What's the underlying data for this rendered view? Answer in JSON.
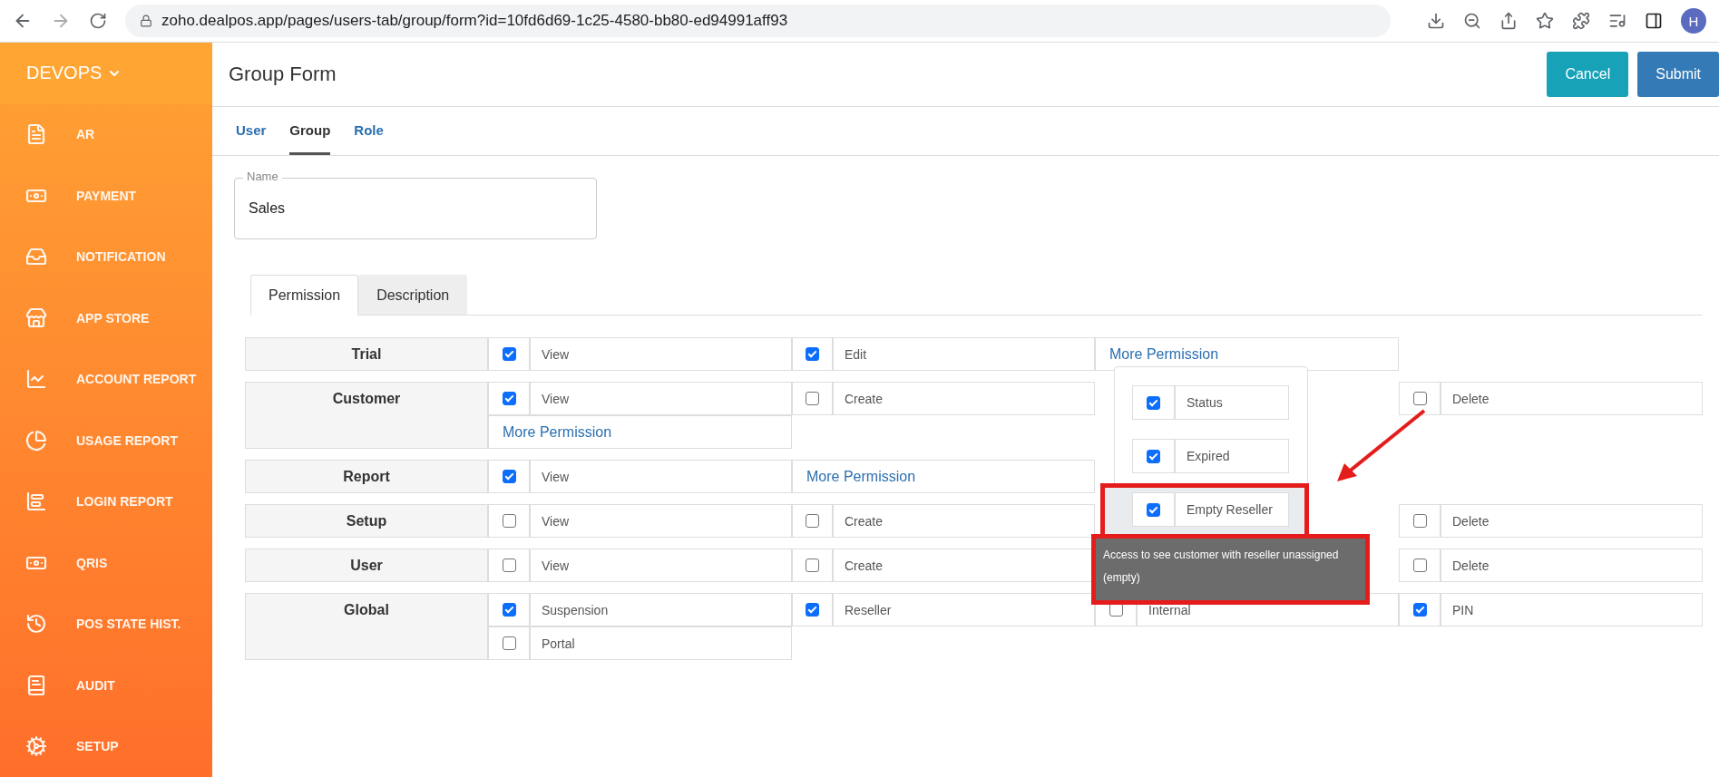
{
  "browser": {
    "url": "zoho.dealpos.app/pages/users-tab/group/form?id=10fd6d69-1c25-4580-bb80-ed94991aff93",
    "profile": "H"
  },
  "sidebar": {
    "brand": "DEVOPS",
    "items": [
      {
        "label": "AR"
      },
      {
        "label": "PAYMENT"
      },
      {
        "label": "NOTIFICATION"
      },
      {
        "label": "APP STORE"
      },
      {
        "label": "ACCOUNT REPORT"
      },
      {
        "label": "USAGE REPORT"
      },
      {
        "label": "LOGIN REPORT"
      },
      {
        "label": "QRIS"
      },
      {
        "label": "POS STATE HIST."
      },
      {
        "label": "AUDIT"
      },
      {
        "label": "SETUP"
      }
    ]
  },
  "header": {
    "title": "Group Form",
    "buttons": [
      {
        "label": "Cancel",
        "kind": "cancel"
      },
      {
        "label": "Submit",
        "kind": "submit"
      }
    ]
  },
  "tabs": [
    {
      "label": "User",
      "selected": false
    },
    {
      "label": "Group",
      "selected": true
    },
    {
      "label": "Role",
      "selected": false
    }
  ],
  "name_field": {
    "label": "Name",
    "value": "Sales"
  },
  "section_tabs": [
    {
      "label": "Permission",
      "selected": true
    },
    {
      "label": "Description",
      "selected": false
    }
  ],
  "permissions": [
    {
      "name": "Trial",
      "cells": [
        {
          "kind": "check",
          "checked": true,
          "label": "View"
        },
        {
          "kind": "check",
          "checked": true,
          "label": "Edit"
        },
        {
          "kind": "link",
          "label": "More Permission"
        }
      ]
    },
    {
      "name": "Customer",
      "cells": [
        {
          "kind": "check",
          "checked": true,
          "label": "View"
        },
        {
          "kind": "check",
          "checked": false,
          "label": "Create"
        },
        {
          "kind": "blank"
        },
        {
          "kind": "check",
          "checked": false,
          "label": "Delete"
        },
        {
          "kind": "link",
          "label": "More Permission"
        }
      ]
    },
    {
      "name": "Report",
      "cells": [
        {
          "kind": "check",
          "checked": true,
          "label": "View"
        },
        {
          "kind": "link",
          "label": "More Permission"
        }
      ]
    },
    {
      "name": "Setup",
      "cells": [
        {
          "kind": "check",
          "checked": false,
          "label": "View"
        },
        {
          "kind": "check",
          "checked": false,
          "label": "Create"
        },
        {
          "kind": "blank"
        },
        {
          "kind": "check",
          "checked": false,
          "label": "Delete"
        }
      ]
    },
    {
      "name": "User",
      "cells": [
        {
          "kind": "check",
          "checked": false,
          "label": "View"
        },
        {
          "kind": "check",
          "checked": false,
          "label": "Create"
        },
        {
          "kind": "blank"
        },
        {
          "kind": "check",
          "checked": false,
          "label": "Delete"
        }
      ]
    },
    {
      "name": "Global",
      "cells": [
        {
          "kind": "check",
          "checked": true,
          "label": "Suspension"
        },
        {
          "kind": "check",
          "checked": true,
          "label": "Reseller"
        },
        {
          "kind": "check",
          "checked": false,
          "label": "Internal"
        },
        {
          "kind": "check",
          "checked": true,
          "label": "PIN"
        },
        {
          "kind": "check",
          "checked": false,
          "label": "Portal"
        }
      ]
    }
  ],
  "popup": {
    "items": [
      {
        "label": "Status",
        "checked": true,
        "highlighted": false
      },
      {
        "label": "Expired",
        "checked": true,
        "highlighted": false
      },
      {
        "label": "Empty Reseller",
        "checked": true,
        "highlighted": true
      }
    ]
  },
  "tooltip": {
    "text": "Access to see customer with reseller unassigned (empty)"
  }
}
